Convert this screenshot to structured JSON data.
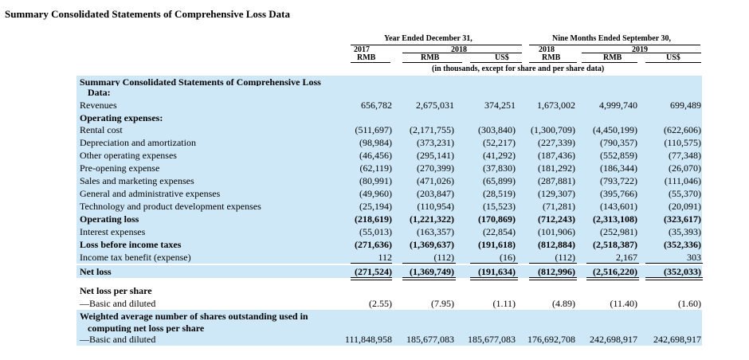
{
  "title": "Summary Consolidated Statements of Comprehensive Loss Data",
  "header": {
    "group1": "Year Ended December 31,",
    "group2": "Nine Months Ended September 30,",
    "years": [
      "2017",
      "2018",
      "2018",
      "2019"
    ],
    "currencies": [
      "RMB",
      "RMB",
      "US$",
      "RMB",
      "RMB",
      "US$"
    ],
    "unit_note": "(in thousands, except for share and per share data)"
  },
  "rows": [
    {
      "label": "Summary Consolidated Statements of Comprehensive Loss",
      "bold": true,
      "values": []
    },
    {
      "label": "Data:",
      "bold": true,
      "indent": true,
      "values": []
    },
    {
      "label": "Revenues",
      "values": [
        "656,782",
        "2,675,031",
        "374,251",
        "1,673,002",
        "4,999,740",
        "699,489"
      ]
    },
    {
      "label": "Operating expenses:",
      "bold": true,
      "values": []
    },
    {
      "label": "Rental cost",
      "values": [
        "(511,697)",
        "(2,171,755)",
        "(303,840)",
        "(1,300,709)",
        "(4,450,199)",
        "(622,606)"
      ]
    },
    {
      "label": "Depreciation and amortization",
      "values": [
        "(98,984)",
        "(373,231)",
        "(52,217)",
        "(227,339)",
        "(790,357)",
        "(110,575)"
      ]
    },
    {
      "label": "Other operating expenses",
      "values": [
        "(46,456)",
        "(295,141)",
        "(41,292)",
        "(187,436)",
        "(552,859)",
        "(77,348)"
      ]
    },
    {
      "label": "Pre-opening expense",
      "values": [
        "(62,119)",
        "(270,399)",
        "(37,830)",
        "(181,292)",
        "(186,344)",
        "(26,070)"
      ]
    },
    {
      "label": "Sales and marketing expenses",
      "values": [
        "(80,991)",
        "(471,026)",
        "(65,899)",
        "(287,881)",
        "(793,722)",
        "(111,046)"
      ]
    },
    {
      "label": "General and administrative expenses",
      "values": [
        "(49,960)",
        "(203,847)",
        "(28,519)",
        "(129,307)",
        "(395,766)",
        "(55,370)"
      ]
    },
    {
      "label": "Technology and product development expenses",
      "values": [
        "(25,194)",
        "(110,954)",
        "(15,523)",
        "(71,281)",
        "(143,601)",
        "(20,091)"
      ]
    },
    {
      "label": "Operating loss",
      "bold": true,
      "values": [
        "(218,619)",
        "(1,221,322)",
        "(170,869)",
        "(712,243)",
        "(2,313,108)",
        "(323,617)"
      ]
    },
    {
      "label": "Interest expenses",
      "values": [
        "(55,013)",
        "(163,357)",
        "(22,854)",
        "(101,906)",
        "(252,981)",
        "(35,393)"
      ]
    },
    {
      "label": "Loss before income taxes",
      "bold": true,
      "values": [
        "(271,636)",
        "(1,369,637)",
        "(191,618)",
        "(812,884)",
        "(2,518,387)",
        "(352,336)"
      ]
    },
    {
      "label": "Income tax benefit (expense)",
      "values": [
        "112",
        "(112)",
        "(16)",
        "(112)",
        "2,167",
        "303"
      ]
    },
    {
      "label": "Net loss",
      "bold": true,
      "values": [
        "(271,524)",
        "(1,369,749)",
        "(191,634)",
        "(812,996)",
        "(2,516,220)",
        "(352,033)"
      ]
    },
    {
      "label": "Net loss per share",
      "bold": true,
      "values": []
    },
    {
      "label": "—Basic and diluted",
      "values": [
        "(2.55)",
        "(7.95)",
        "(1.11)",
        "(4.89)",
        "(11.40)",
        "(1.60)"
      ]
    },
    {
      "label": "Weighted average number of shares outstanding used in",
      "bold": true,
      "values": []
    },
    {
      "label": "computing net loss per share",
      "bold": true,
      "indent": true,
      "values": []
    },
    {
      "label": "—Basic and diluted",
      "values": [
        "111,848,958",
        "185,677,083",
        "185,677,083",
        "176,692,708",
        "242,698,917",
        "242,698,917"
      ]
    }
  ]
}
